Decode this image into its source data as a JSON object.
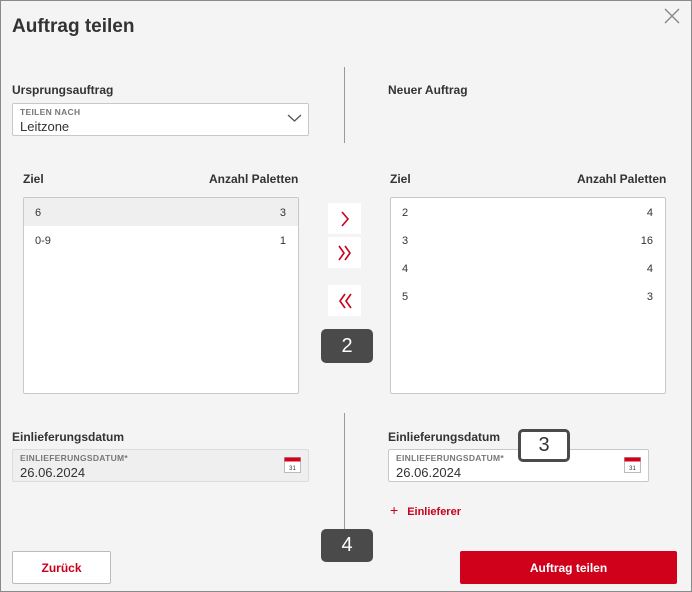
{
  "dialog": {
    "title": "Auftrag teilen"
  },
  "left": {
    "section_label": "Ursprungsauftrag",
    "split_field": {
      "label": "TEILEN NACH",
      "value": "Leitzone"
    },
    "columns": {
      "target": "Ziel",
      "pallets": "Anzahl Paletten"
    },
    "rows": [
      {
        "target": "6",
        "pallets": "3"
      },
      {
        "target": "0-9",
        "pallets": "1"
      }
    ],
    "date_section_label": "Einlieferungsdatum",
    "date_field": {
      "label": "EINLIEFERUNGSDATUM*",
      "value": "26.06.2024"
    }
  },
  "right": {
    "section_label": "Neuer Auftrag",
    "columns": {
      "target": "Ziel",
      "pallets": "Anzahl Paletten"
    },
    "rows": [
      {
        "target": "2",
        "pallets": "4"
      },
      {
        "target": "3",
        "pallets": "16"
      },
      {
        "target": "4",
        "pallets": "4"
      },
      {
        "target": "5",
        "pallets": "3"
      }
    ],
    "date_section_label": "Einlieferungsdatum",
    "date_field": {
      "label": "EINLIEFERUNGSDATUM*",
      "value": "26.06.2024"
    },
    "add_supplier_label": "Einlieferer"
  },
  "transfer": {
    "move_one_icon": "chevron-right-icon",
    "move_all_icon": "double-chevron-right-icon",
    "move_back_icon": "double-chevron-left-icon"
  },
  "callouts": {
    "c2": "2",
    "c3": "3",
    "c4": "4"
  },
  "calendar_icon_text": "31",
  "buttons": {
    "back": "Zurück",
    "submit": "Auftrag teilen"
  },
  "colors": {
    "accent": "#c8001c",
    "primary_button": "#d0021b",
    "callout": "#4a4a4a"
  }
}
